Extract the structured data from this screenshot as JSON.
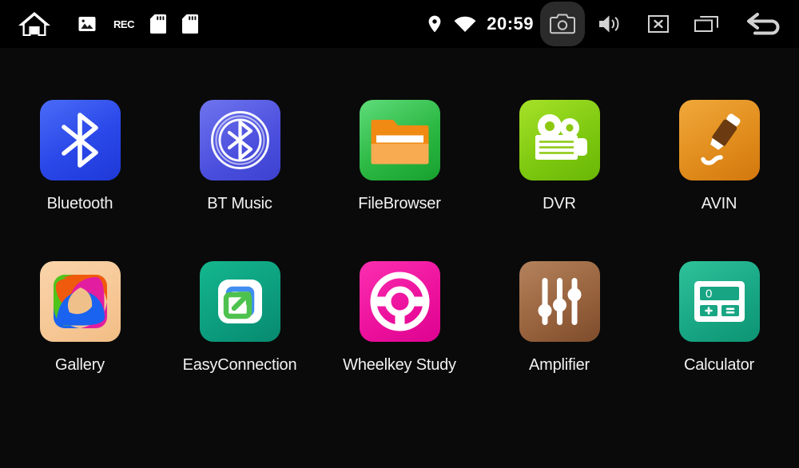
{
  "status_bar": {
    "left_icons": [
      {
        "name": "home-icon",
        "label": "Home"
      },
      {
        "name": "photo-icon",
        "label": "Photo"
      },
      {
        "name": "rec-icon",
        "label": "REC"
      },
      {
        "name": "sd-card-1-icon",
        "label": "SD Card 1"
      },
      {
        "name": "sd-card-2-icon",
        "label": "SD Card 2"
      }
    ],
    "rec_text": "REC",
    "location_icon": "location-pin-icon",
    "wifi_icon": "wifi-icon",
    "clock": "20:59",
    "right_icons": [
      {
        "name": "camera-icon",
        "label": "Screenshot",
        "active": true
      },
      {
        "name": "volume-icon",
        "label": "Volume"
      },
      {
        "name": "close-box-icon",
        "label": "Close"
      },
      {
        "name": "recent-apps-icon",
        "label": "Recent Apps"
      },
      {
        "name": "back-icon",
        "label": "Back"
      }
    ]
  },
  "app_grid": {
    "rows": [
      [
        {
          "id": "bluetooth",
          "label": "Bluetooth",
          "icon": "bluetooth-icon",
          "color": "#2a47e8"
        },
        {
          "id": "btmusic",
          "label": "BT Music",
          "icon": "bt-music-icon",
          "color": "#4b4fdd"
        },
        {
          "id": "filebrowser",
          "label": "FileBrowser",
          "icon": "folder-icon",
          "color": "#2cb843"
        },
        {
          "id": "dvr",
          "label": "DVR",
          "icon": "video-camera-icon",
          "color": "#7cc70f"
        },
        {
          "id": "avin",
          "label": "AVIN",
          "icon": "av-plug-icon",
          "color": "#e08b1b"
        }
      ],
      [
        {
          "id": "gallery",
          "label": "Gallery",
          "icon": "gallery-pinwheel-icon",
          "color": "#f6c795"
        },
        {
          "id": "easyconnection",
          "label": "EasyConnection",
          "icon": "screen-share-icon",
          "color": "#0c9c7d"
        },
        {
          "id": "wheelkey",
          "label": "Wheelkey Study",
          "icon": "steering-wheel-icon",
          "color": "#ec109c"
        },
        {
          "id": "amplifier",
          "label": "Amplifier",
          "icon": "equalizer-icon",
          "color": "#96613c"
        },
        {
          "id": "calculator",
          "label": "Calculator",
          "icon": "calculator-icon",
          "color": "#17a583"
        }
      ]
    ]
  },
  "calculator_display": "0",
  "calculator_keys": [
    "+",
    "="
  ],
  "theme": {
    "background": "#0a0a0a",
    "status_bar_background": "#000000",
    "label_color": "#f2f2f2",
    "active_button_background": "#2b2b2b"
  }
}
